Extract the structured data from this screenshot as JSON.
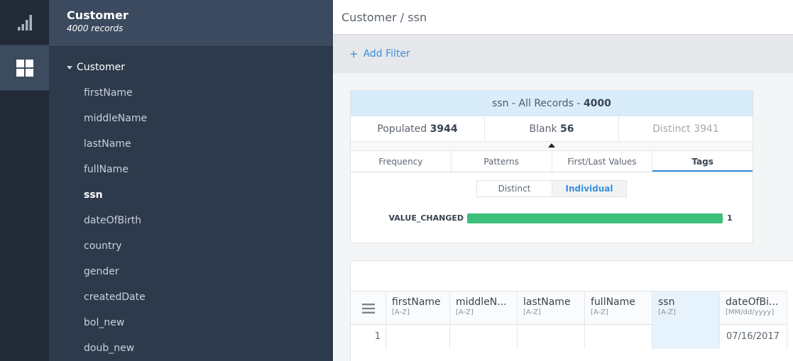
{
  "sidebar": {
    "title": "Customer",
    "subtitle": "4000 records",
    "group": "Customer",
    "fields": [
      "firstName",
      "middleName",
      "lastName",
      "fullName",
      "ssn",
      "dateOfBirth",
      "country",
      "gender",
      "createdDate",
      "bol_new",
      "doub_new"
    ],
    "selected": "ssn"
  },
  "rail": {
    "icons": [
      "bar-chart-icon",
      "grid-icon"
    ],
    "active": "grid-icon"
  },
  "breadcrumb": "Customer / ssn",
  "filter": {
    "plus": "+",
    "label": "Add Filter"
  },
  "summary": {
    "head_prefix": "ssn - All Records - ",
    "head_total": "4000",
    "populated_label": "Populated",
    "populated_value": "3944",
    "blank_label": "Blank",
    "blank_value": "56",
    "distinct_label": "Distinct",
    "distinct_value": "3941"
  },
  "tabs": [
    "Frequency",
    "Patterns",
    "First/Last Values",
    "Tags"
  ],
  "active_tab": "Tags",
  "toggle": {
    "options": [
      "Distinct",
      "Individual"
    ],
    "active": "Individual"
  },
  "tags": [
    {
      "label": "VALUE_CHANGED",
      "count": "1",
      "fraction": 1.0
    }
  ],
  "grid": {
    "columns": [
      {
        "name": "firstName",
        "format": "[A-Z]"
      },
      {
        "name": "middleN...",
        "format": "[A-Z]"
      },
      {
        "name": "lastName",
        "format": "[A-Z]"
      },
      {
        "name": "fullName",
        "format": "[A-Z]"
      },
      {
        "name": "ssn",
        "format": "[A-Z]"
      },
      {
        "name": "dateOfBi...",
        "format": "[MM/dd/yyyy]"
      }
    ],
    "rows": [
      {
        "index": "1",
        "cells": [
          "",
          "",
          "",
          "",
          "",
          "07/16/2017"
        ]
      }
    ]
  },
  "colors": {
    "accent": "#3a8fd9",
    "tag_bar": "#3cbf7a",
    "sidebar_bg": "#2d3a4b",
    "rail_bg": "#212a36"
  }
}
